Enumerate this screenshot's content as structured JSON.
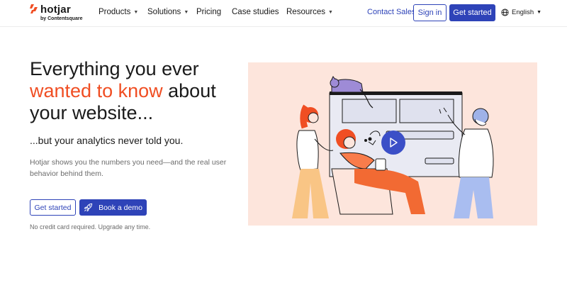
{
  "brand": {
    "name": "hotjar",
    "tagline": "by Contentsquare",
    "accent_color": "#f04e23",
    "primary_color": "#2e43b8"
  },
  "nav": {
    "items": [
      {
        "label": "Products",
        "has_dropdown": true
      },
      {
        "label": "Solutions",
        "has_dropdown": true
      },
      {
        "label": "Pricing",
        "has_dropdown": false
      },
      {
        "label": "Case studies",
        "has_dropdown": false
      },
      {
        "label": "Resources",
        "has_dropdown": true
      }
    ],
    "contact_sales": "Contact Sales",
    "sign_in": "Sign in",
    "get_started": "Get started",
    "language": "English"
  },
  "hero": {
    "headline_part1": "Everything you ever",
    "headline_accent": "wanted to know",
    "headline_part2": "about your website...",
    "subheadline": "...but your analytics never told you.",
    "description": "Hotjar shows you the numbers you need—and the real user behavior behind them.",
    "cta_primary": "Get started",
    "cta_secondary": "Book a demo",
    "note": "No credit card required. Upgrade any time."
  },
  "illustration": {
    "background_color": "#fde5dc",
    "play_button_color": "#3b4fc7"
  }
}
